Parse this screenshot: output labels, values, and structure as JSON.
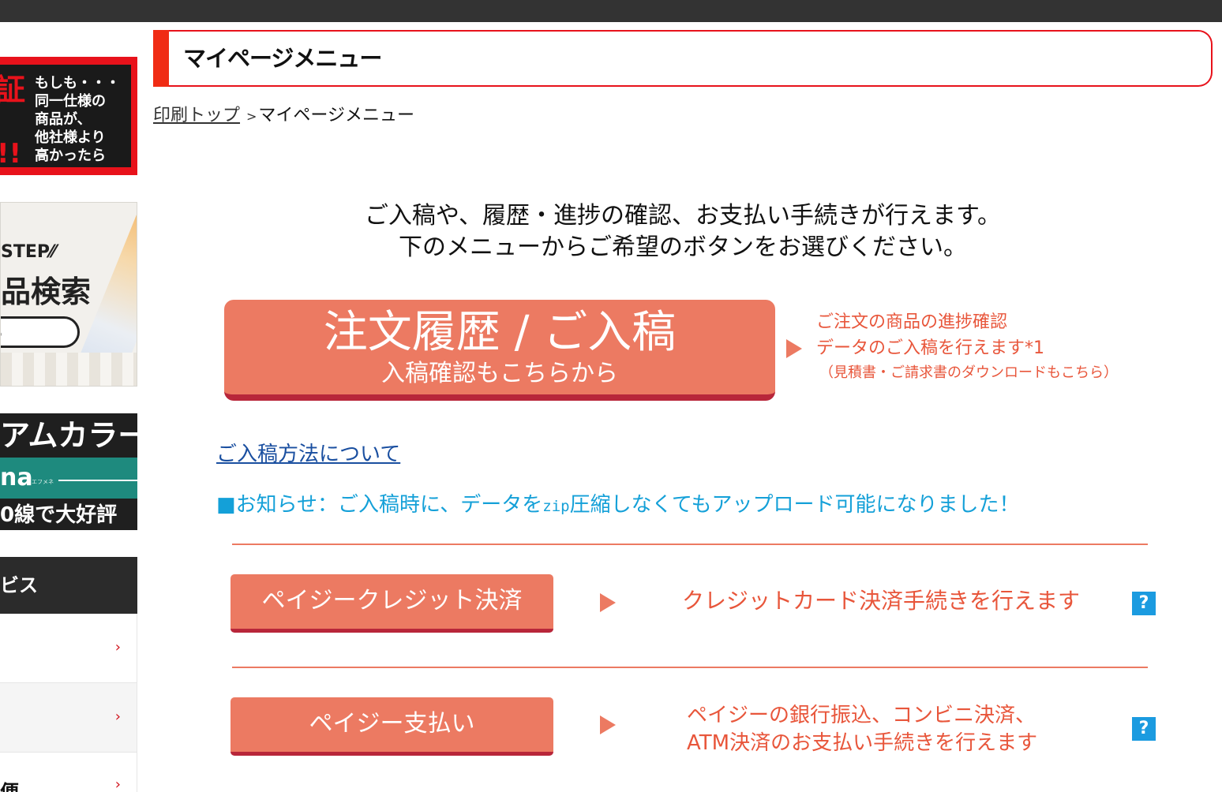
{
  "sidebar": {
    "guarantee_banner": {
      "icon_char": "証",
      "exclaim": "!!",
      "note": "もしも・・・\n同一仕様の\n商品が、\n他社様より\n高かったら"
    },
    "search_banner": {
      "step": "STEP",
      "title": "品検索",
      "button": "る"
    },
    "color_banner": {
      "line1": "アムカラー",
      "line2": "na",
      "line2_small": "エフメネ",
      "line3": "0線で大好評"
    },
    "nav": {
      "heading": "ビス",
      "items": [
        {
          "label": "",
          "chevron": "›"
        },
        {
          "label": "",
          "chevron": "›"
        },
        {
          "label": "便",
          "chevron": "›"
        }
      ]
    }
  },
  "header": {
    "title": "マイページメニュー"
  },
  "breadcrumb": {
    "home": "印刷トップ",
    "separator": ">",
    "current": "マイページメニュー"
  },
  "intro": {
    "line1": "ご入稿や、履歴・進捗の確認、お支払い手続きが行えます。",
    "line2": "下のメニューからご希望のボタンをお選びください。"
  },
  "order": {
    "button_main": "注文履歴 / ご入稿",
    "button_sub": "入稿確認もこちらから",
    "desc_line1": "ご注文の商品の進捗確認",
    "desc_line2": "データのご入稿を行えます*1",
    "desc_line3": "（見積書・ご請求書のダウンロードもこちら）"
  },
  "links": {
    "upload_guide": "ご入稿方法について"
  },
  "notice": {
    "prefix": "■お知らせ：ご入稿時に、データを",
    "zip": "zip",
    "suffix": "圧縮しなくてもアップロード可能になりました！"
  },
  "payments": [
    {
      "button": "ペイジークレジット決済",
      "desc_line1": "クレジットカード決済手続きを行えます",
      "desc_line2": "",
      "help": "?"
    },
    {
      "button": "ペイジー支払い",
      "desc_line1": "ペイジーの銀行振込、コンビニ決済、",
      "desc_line2": "ATM決済のお支払い手続きを行えます",
      "help": "?"
    }
  ],
  "colors": {
    "accent_red": "#e8121b",
    "button_salmon": "#ec7a62",
    "button_shadow": "#b8263a",
    "desc_text": "#e8563b",
    "link_blue": "#1a4fa0",
    "notice_blue": "#14a0d8",
    "help_blue": "#1b9be0"
  }
}
